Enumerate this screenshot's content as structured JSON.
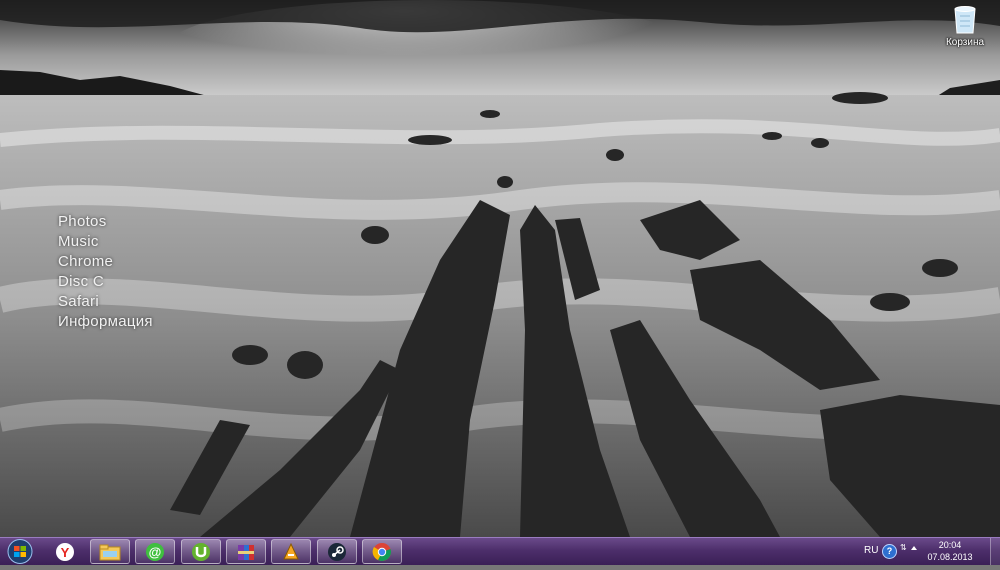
{
  "desktop": {
    "launcher_items": [
      "Photos",
      "Music",
      "Chrome",
      "Disc C",
      "Safari",
      "Информация"
    ],
    "recycle_bin_label": "Корзина"
  },
  "taskbar": {
    "pinned_icons": [
      "yandex-browser-icon",
      "windows-explorer-icon",
      "mail-agent-icon",
      "utorrent-icon",
      "winrar-icon",
      "aimp-icon",
      "steam-icon",
      "chrome-icon"
    ],
    "tray": {
      "language": "RU",
      "help_glyph": "?",
      "clock_time": "20:04",
      "clock_date": "07.08.2013"
    }
  },
  "colors": {
    "taskbar": "#4d2f6b",
    "launcher_text": "#f2f2f2"
  }
}
